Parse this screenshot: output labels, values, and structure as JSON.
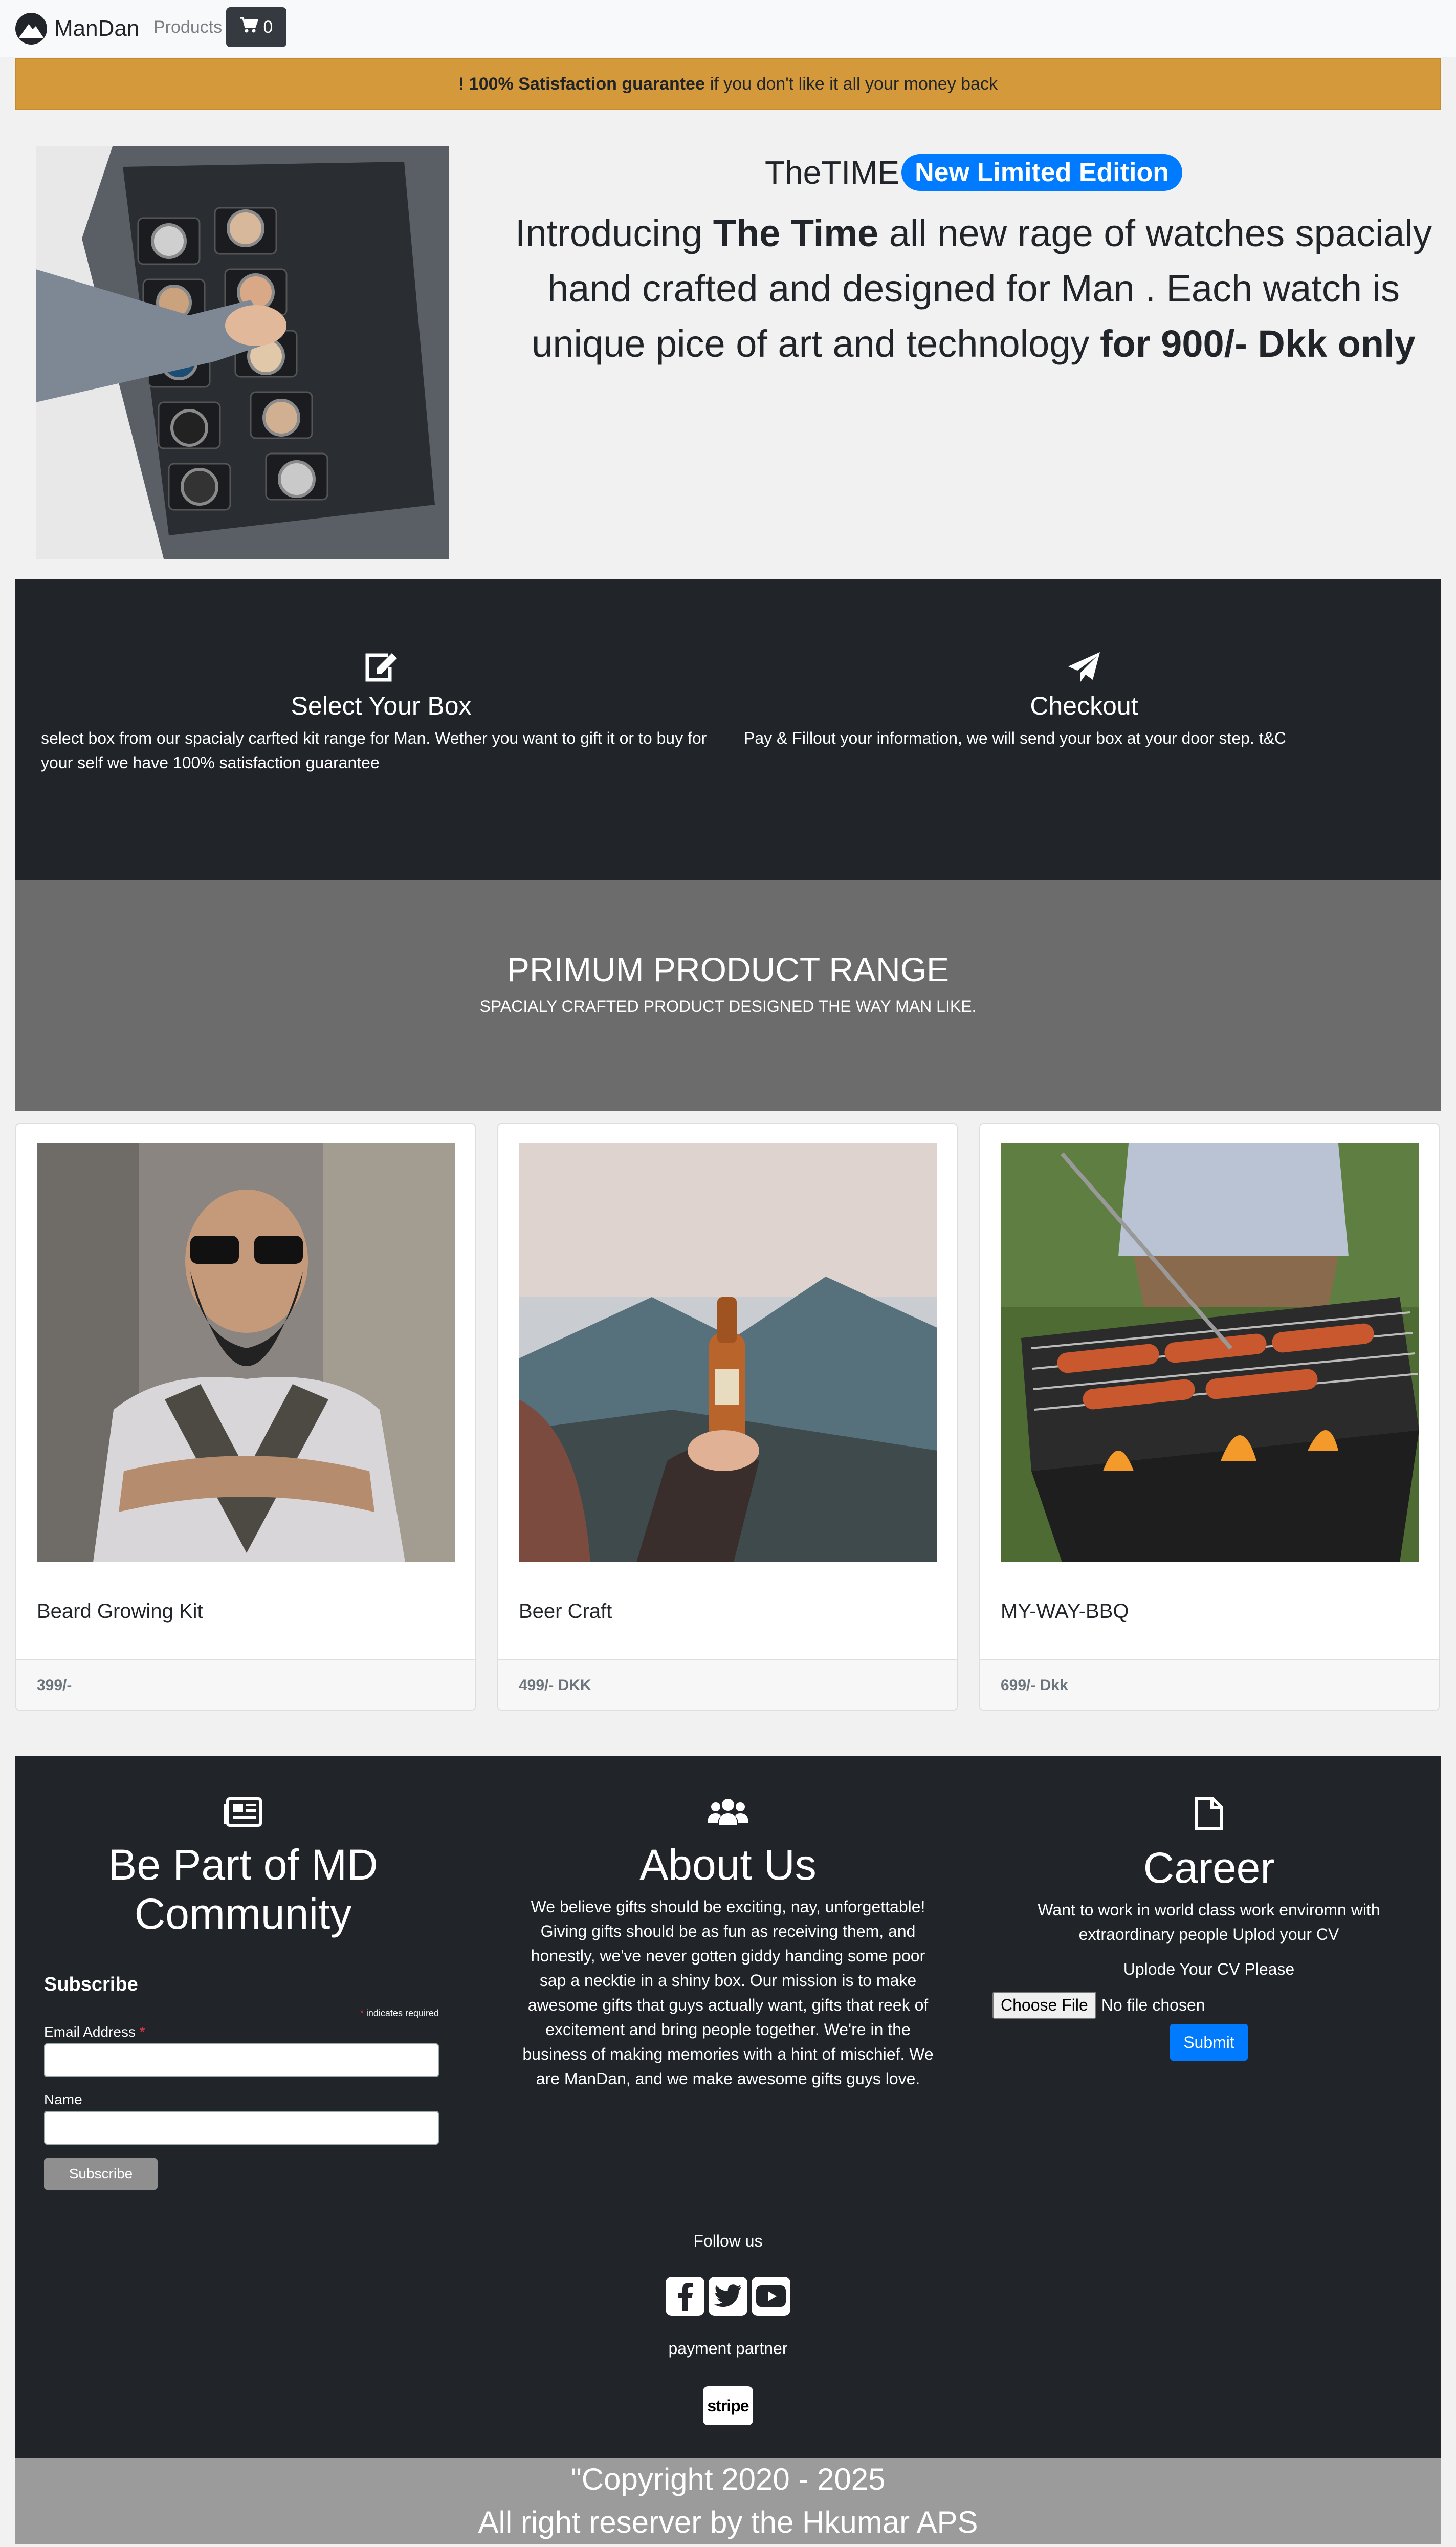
{
  "nav": {
    "brand": "ManDan",
    "products_link": "Products",
    "cart_count": "0",
    "icons": {
      "logo": "mountain-logo-icon",
      "cart": "shopping-cart-icon"
    }
  },
  "banner": {
    "bold": "! 100% Satisfaction guarantee",
    "text": "if you don't like it all your money back"
  },
  "hero": {
    "title": "TheTIME",
    "badge": "New Limited Edition",
    "text_1": "Introducing ",
    "text_bold_1": "The Time",
    "text_2": " all new rage of watches spacialy hand crafted and designed for Man . Each watch is unique pice of art and technology ",
    "text_bold_2": "for 900/- Dkk only"
  },
  "steps": [
    {
      "icon": "edit-icon",
      "title": "Select Your Box",
      "text": "select box from our spacialy carfted kit range for Man. Wether you want to gift it or to buy for your self we have 100% satisfaction guarantee"
    },
    {
      "icon": "paper-plane-icon",
      "title": "Checkout",
      "text": "Pay & Fillout your information, we will send your box at your door step. t&C"
    }
  ],
  "premium": {
    "title": "PRIMUM PRODUCT RANGE",
    "subtitle": "SPACIALY CRAFTED PRODUCT DESIGNED THE WAY MAN LIKE."
  },
  "products": [
    {
      "name": "Beard Growing Kit",
      "price": "399/-"
    },
    {
      "name": "Beer Craft",
      "price": "499/- DKK"
    },
    {
      "name": "MY-WAY-BBQ",
      "price": "699/- Dkk"
    }
  ],
  "footer": {
    "community": {
      "icon": "newspaper-icon",
      "title": "Be Part of MD Community",
      "subscribe_heading": "Subscribe",
      "required_note": "indicates required",
      "required_mark": "*",
      "email_label": "Email Address",
      "name_label": "Name",
      "subscribe_button": "Subscribe"
    },
    "about": {
      "icon": "users-icon",
      "title": "About Us",
      "text": "We believe gifts should be exciting, nay, unforgettable! Giving gifts should be as fun as receiving them, and honestly, we've never gotten giddy handing some poor sap a necktie in a shiny box. Our mission is to make awesome gifts that guys actually want, gifts that reek of excitement and bring people together. We're in the business of making memories with a hint of mischief. We are ManDan, and we make awesome gifts guys love."
    },
    "career": {
      "icon": "file-icon",
      "title": "Career",
      "text": "Want to work in world class work enviromn with extraordinary people Uplod your CV",
      "upload_label": "Uplode Your CV Please",
      "file_button": "Choose File",
      "file_status": "No file chosen",
      "submit_button": "Submit"
    },
    "follow": "Follow us",
    "social_icons": [
      "facebook-icon",
      "twitter-icon",
      "youtube-icon"
    ],
    "payment": "payment partner",
    "payment_logo": "stripe"
  },
  "copyright": {
    "line_1": "\"Copyright 2020 - 2025",
    "line_2": "All right reserver by the Hkumar APS"
  }
}
